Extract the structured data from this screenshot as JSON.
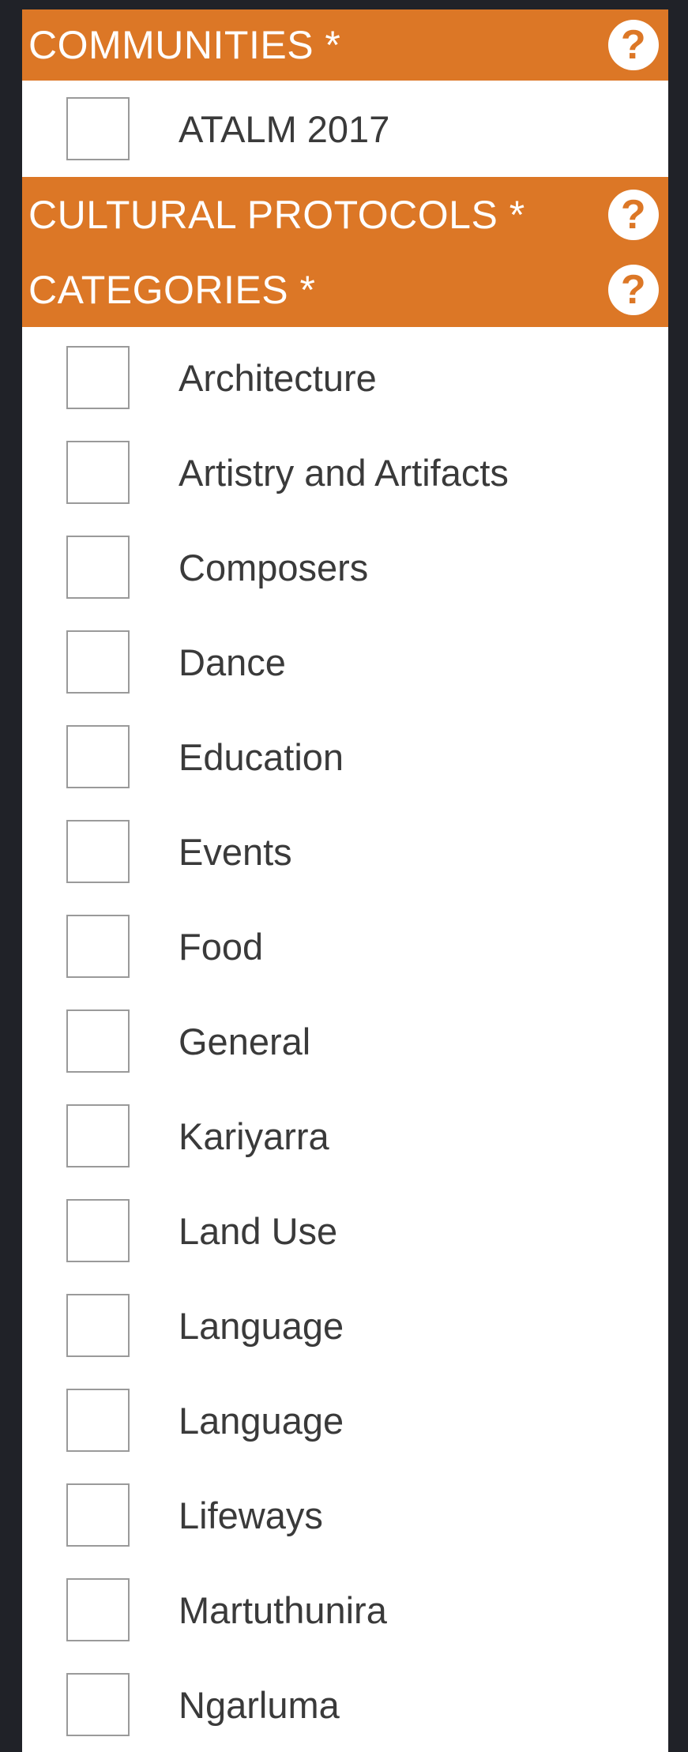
{
  "communities": {
    "title": "COMMUNITIES *",
    "help_icon": "?",
    "items": [
      {
        "label": "ATALM 2017",
        "checked": false
      }
    ]
  },
  "cultural_protocols": {
    "title": "CULTURAL PROTOCOLS *",
    "help_icon": "?"
  },
  "categories": {
    "title": "CATEGORIES *",
    "help_icon": "?",
    "items": [
      {
        "label": "Architecture",
        "checked": false
      },
      {
        "label": "Artistry and Artifacts",
        "checked": false
      },
      {
        "label": "Composers",
        "checked": false
      },
      {
        "label": "Dance",
        "checked": false
      },
      {
        "label": "Education",
        "checked": false
      },
      {
        "label": "Events",
        "checked": false
      },
      {
        "label": "Food",
        "checked": false
      },
      {
        "label": "General",
        "checked": false
      },
      {
        "label": "Kariyarra",
        "checked": false
      },
      {
        "label": "Land Use",
        "checked": false
      },
      {
        "label": "Language",
        "checked": false
      },
      {
        "label": "Language",
        "checked": false
      },
      {
        "label": "Lifeways",
        "checked": false
      },
      {
        "label": "Martuthunira",
        "checked": false
      },
      {
        "label": "Ngarluma",
        "checked": false
      }
    ]
  },
  "colors": {
    "header_bg": "#dc7726",
    "page_bg": "#202228",
    "panel_bg": "#ffffff"
  },
  "icons": {
    "help": "question-circle-icon"
  }
}
